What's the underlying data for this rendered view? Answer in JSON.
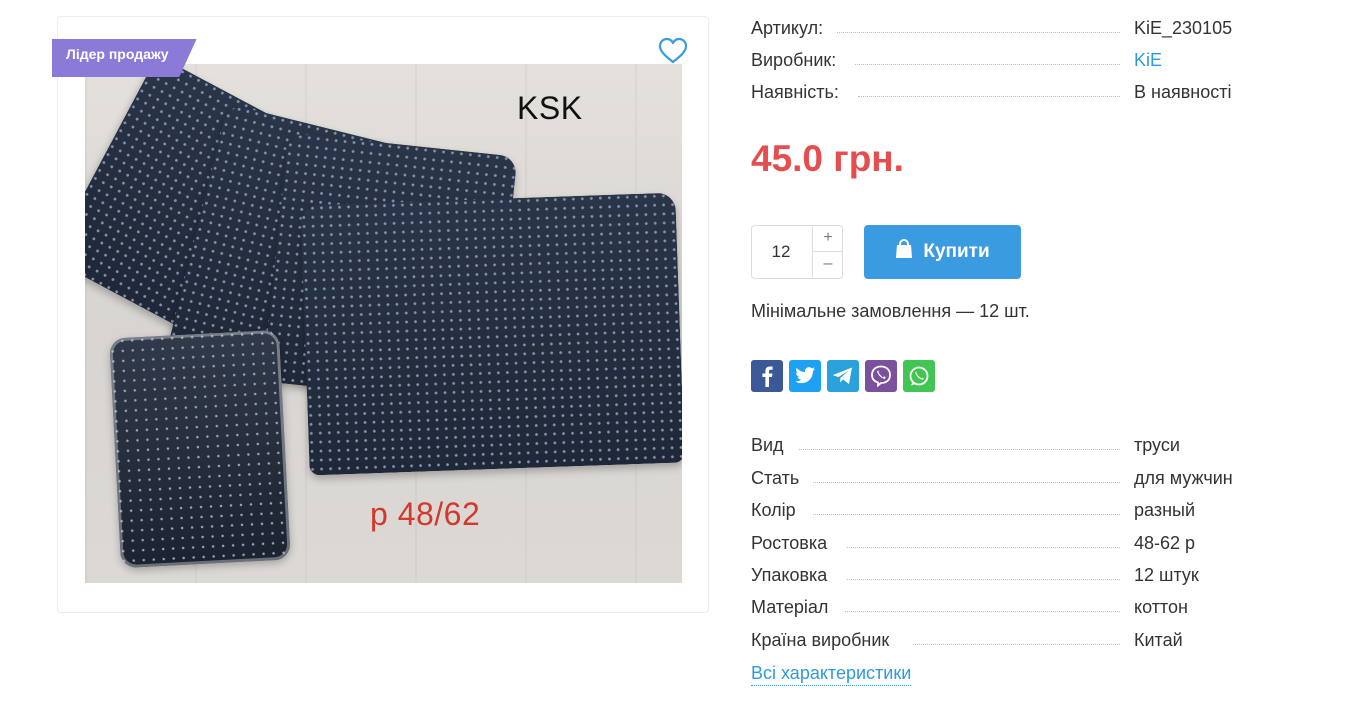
{
  "product": {
    "badge": "Лідер продажу",
    "photo_texts": {
      "brand": "KSK",
      "size": "р 48/62"
    }
  },
  "meta": [
    {
      "key": "Артикул:",
      "value": "KiE_230105",
      "link": false
    },
    {
      "key": "Виробник:",
      "value": "KiE",
      "link": true
    },
    {
      "key": "Наявність:",
      "value": "В наявності",
      "link": false
    }
  ],
  "price": "45.0 грн.",
  "purchase": {
    "quantity": "12",
    "plus": "+",
    "minus": "–",
    "buy_label": "Купити",
    "min_order": "Мінімальне замовлення — 12 шт."
  },
  "social": [
    {
      "name": "facebook",
      "icon": "facebook-icon",
      "color": "#3b5998"
    },
    {
      "name": "twitter",
      "icon": "twitter-icon",
      "color": "#1da1f2"
    },
    {
      "name": "telegram",
      "icon": "telegram-icon",
      "color": "#2aa1da"
    },
    {
      "name": "viber",
      "icon": "viber-icon",
      "color": "#7b519d"
    },
    {
      "name": "whatsapp",
      "icon": "whatsapp-icon",
      "color": "#43c553"
    }
  ],
  "specs": [
    {
      "key": "Вид",
      "value": "труси"
    },
    {
      "key": "Стать",
      "value": "для мужчин"
    },
    {
      "key": "Колір",
      "value": "разный"
    },
    {
      "key": "Ростовка",
      "value": "48-62 р"
    },
    {
      "key": "Упаковка",
      "value": "12 штук"
    },
    {
      "key": "Матеріал",
      "value": "коттон"
    },
    {
      "key": "Країна виробник",
      "value": "Китай"
    }
  ],
  "all_specs_link": "Всі характеристики",
  "colors": {
    "accent": "#3b9be0",
    "price": "#e54e4e",
    "badge": "#8c7ad9",
    "link": "#2d9bdc"
  }
}
